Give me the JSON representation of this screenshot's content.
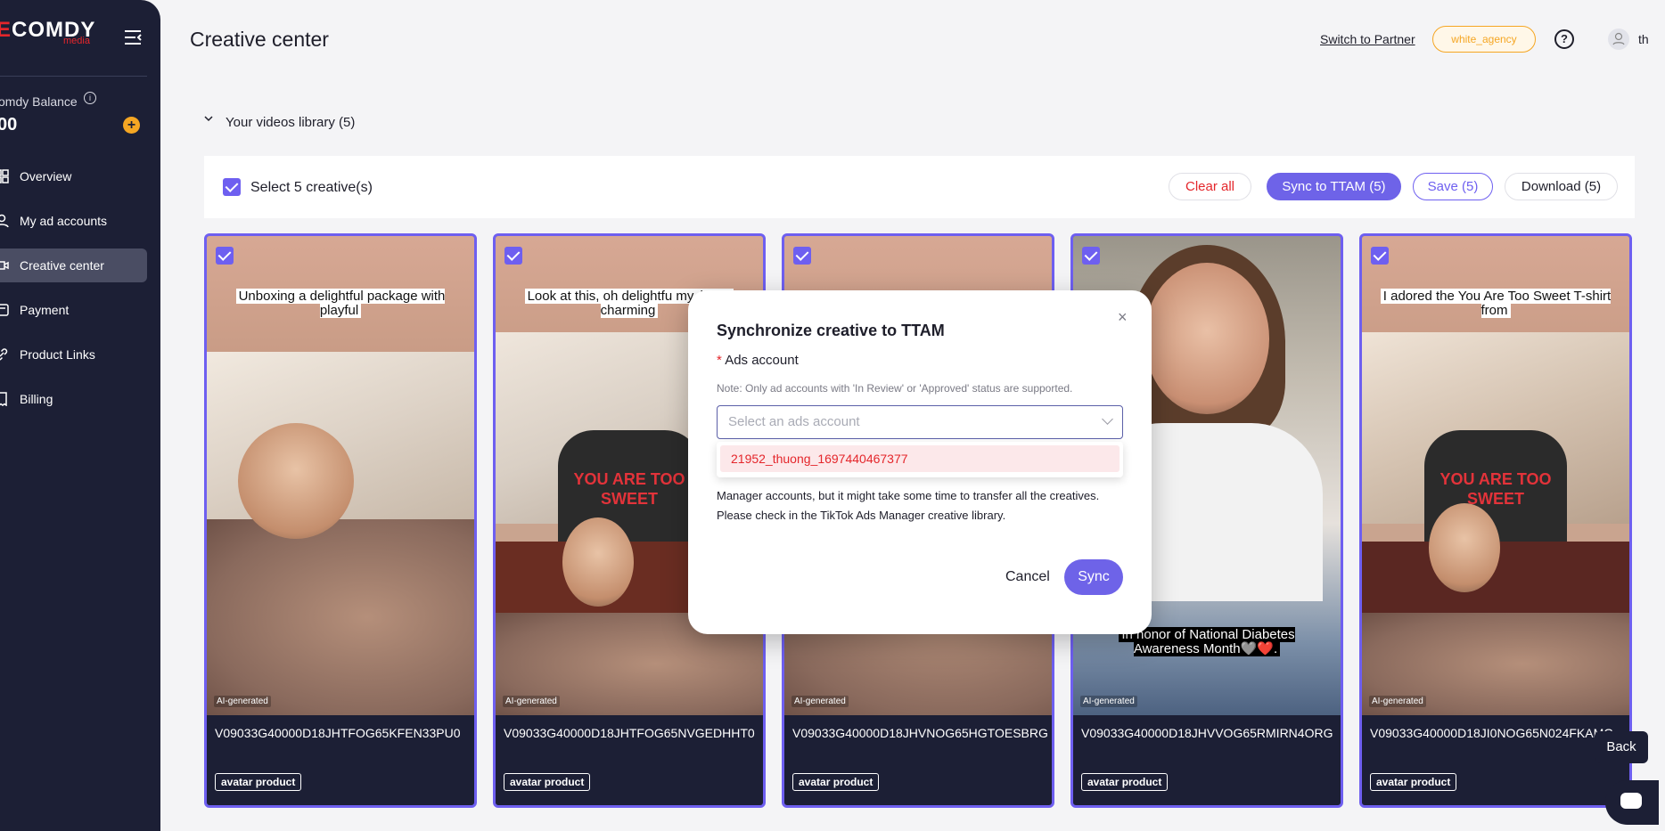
{
  "sidebar": {
    "logo_text": "COMDY",
    "logo_e": "E",
    "logo_sub": "media",
    "balance_label": "omdy Balance",
    "balance_value": "00",
    "items": [
      {
        "label": "Overview",
        "icon": "grid-icon",
        "active": false
      },
      {
        "label": "My ad accounts",
        "icon": "user-icon",
        "active": false
      },
      {
        "label": "Creative center",
        "icon": "video-icon",
        "active": true
      },
      {
        "label": "Payment",
        "icon": "payment-icon",
        "active": false
      },
      {
        "label": "Product Links",
        "icon": "link-icon",
        "active": false
      },
      {
        "label": "Billing",
        "icon": "billing-icon",
        "active": false
      }
    ]
  },
  "header": {
    "title": "Creative center",
    "switch_partner": "Switch to Partner",
    "agency": "white_agency",
    "help": "?",
    "user": "th"
  },
  "library": {
    "title": "Your videos library (5)",
    "select_label": "Select 5 creative(s)",
    "clear_all": "Clear all",
    "sync": "Sync to TTAM (5)",
    "save": "Save (5)",
    "download": "Download (5)"
  },
  "cards": [
    {
      "caption": "Unboxing a delightful package with playful",
      "ai_label": "AI-generated",
      "id": "V09033G40000D18JHTFOG65KFEN33PU0",
      "tag": "avatar product"
    },
    {
      "caption": "Look at this, oh delightfu my, isn't it charming",
      "ai_label": "AI-generated",
      "id": "V09033G40000D18JHTFOG65NVGEDHHT0",
      "tag": "avatar product"
    },
    {
      "caption": "",
      "ai_label": "AI-generated",
      "id": "V09033G40000D18JHVNOG65HGTOESBRG",
      "tag": "avatar product"
    },
    {
      "caption": "In honor of National Diabetes Awareness Month🩶❤️.",
      "ai_label": "AI-generated",
      "id": "V09033G40000D18JHVVOG65RMIRN4ORG",
      "tag": "avatar product"
    },
    {
      "caption": "I adored the You Are Too Sweet T-shirt from",
      "ai_label": "AI-generated",
      "id": "V09033G40000D18JI0NOG65N024FKAMG",
      "tag": "avatar product"
    }
  ],
  "shirt_text": "YOU ARE TOO SWEET",
  "modal": {
    "title": "Synchronize creative to TTAM",
    "close": "×",
    "field_required": "*",
    "field_label": "Ads account",
    "note": "Note: Only ad accounts with 'In Review' or 'Approved' status are supported.",
    "select_placeholder": "Select an ads account",
    "option": "21952_thuong_1697440467377",
    "body_text": "Manager accounts, but it might take some time to transfer all the creatives. Please check in the TikTok Ads Manager creative library.",
    "cancel": "Cancel",
    "sync": "Sync"
  },
  "floating": {
    "back": "Back"
  },
  "colors": {
    "accent": "#6e5ff0",
    "brand_red": "#e4262b",
    "sidebar_bg": "#1c1f35",
    "agency_orange": "#f5a623"
  }
}
